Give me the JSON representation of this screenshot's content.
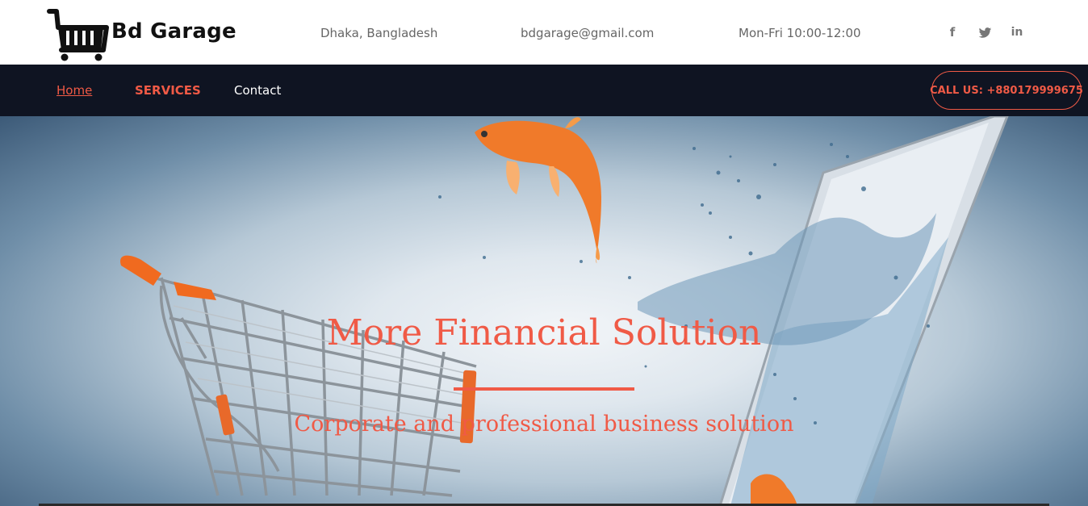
{
  "brand": {
    "name": "Bd Garage",
    "logo_icon": "shopping-cart-icon"
  },
  "header": {
    "location": "Dhaka, Bangladesh",
    "email": "bdgarage@gmail.com",
    "hours": "Mon-Fri 10:00-12:00"
  },
  "social": [
    {
      "name": "facebook-icon",
      "glyph": "f"
    },
    {
      "name": "twitter-icon",
      "glyph": ""
    },
    {
      "name": "linkedin-icon",
      "glyph": "in"
    }
  ],
  "nav": {
    "items": [
      {
        "label": "Home",
        "active": true
      },
      {
        "label": "SERVICES"
      },
      {
        "label": "Contact"
      }
    ],
    "call_label": "CALL US: +880179999675"
  },
  "hero": {
    "title": "More Financial Solution",
    "subtitle": "Corporate and professional business solution"
  },
  "colors": {
    "accent": "#f05a46",
    "nav_bg": "#0f1422",
    "text_muted": "#666666"
  }
}
